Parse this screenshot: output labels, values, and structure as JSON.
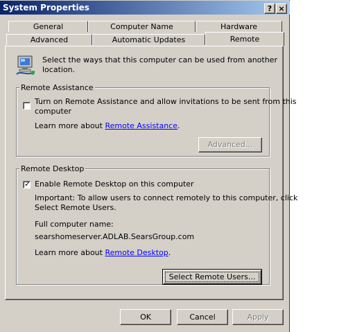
{
  "window": {
    "title": "System Properties",
    "help_btn": "?",
    "close_btn": "×"
  },
  "tabs": {
    "row1": [
      "General",
      "Computer Name",
      "Hardware"
    ],
    "row2": [
      "Advanced",
      "Automatic Updates",
      "Remote"
    ],
    "active": "Remote"
  },
  "intro": {
    "line1": "Select the ways that this computer can be used from another",
    "line2": "location.",
    "icon": "remote-computer-icon"
  },
  "remote_assistance": {
    "label": "Remote Assistance",
    "checkbox_line1": "Turn on Remote Assistance and allow invitations to be sent from this",
    "checkbox_line2": "computer",
    "checked": false,
    "learn_prefix": "Learn more about ",
    "learn_link": "Remote Assistance",
    "learn_suffix": ".",
    "advanced_btn": "Advanced..."
  },
  "remote_desktop": {
    "label": "Remote Desktop",
    "checkbox_label": "Enable Remote Desktop on this computer",
    "checked": true,
    "important_line1": "Important: To allow users to connect remotely to this computer, click",
    "important_line2": "Select Remote Users.",
    "full_name_label": "Full computer name:",
    "full_name_value": "searshomeserver.ADLAB.SearsGroup.com",
    "learn_prefix": "Learn more about ",
    "learn_link": "Remote Desktop",
    "learn_suffix": ".",
    "select_users_btn": "Select Remote Users..."
  },
  "footer": {
    "ok": "OK",
    "cancel": "Cancel",
    "apply": "Apply"
  }
}
